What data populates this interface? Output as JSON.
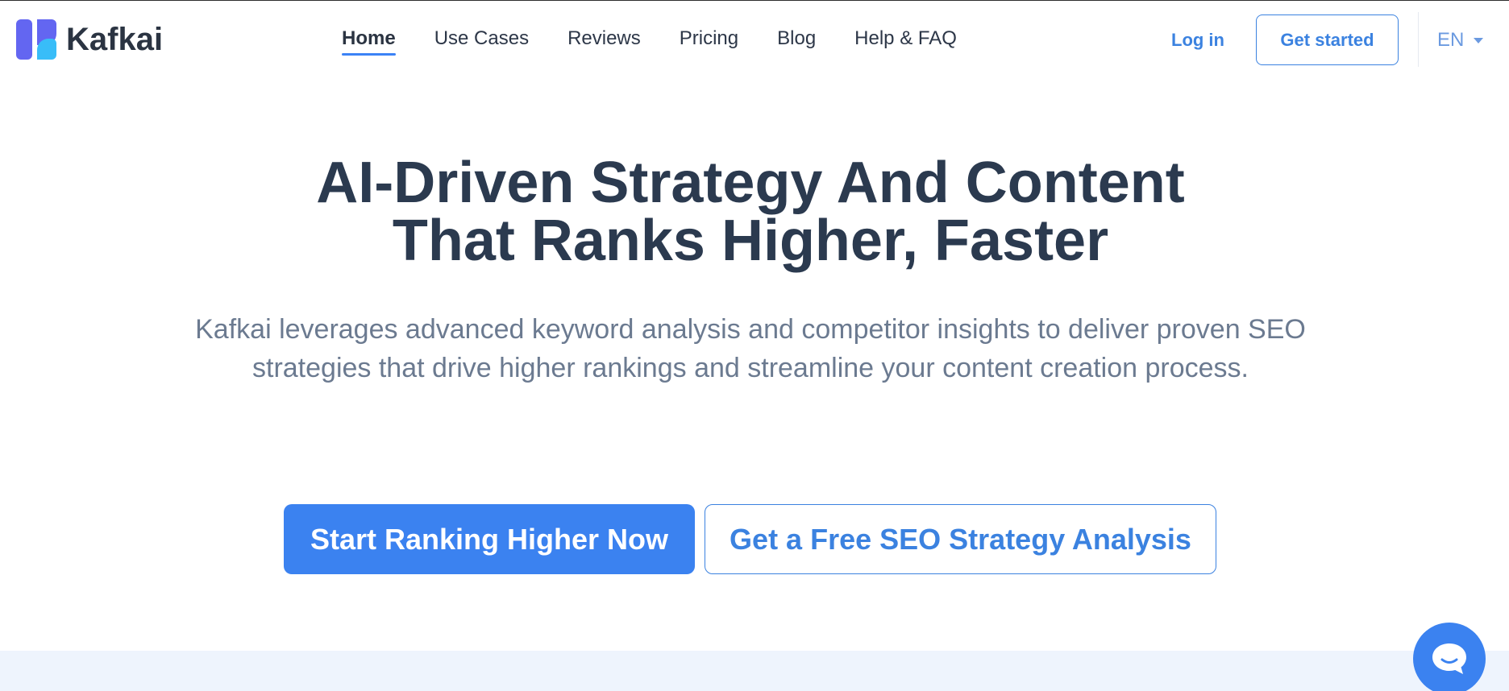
{
  "header": {
    "brand": "Kafkai",
    "nav": [
      {
        "label": "Home",
        "active": true
      },
      {
        "label": "Use Cases"
      },
      {
        "label": "Reviews"
      },
      {
        "label": "Pricing"
      },
      {
        "label": "Blog"
      },
      {
        "label": "Help & FAQ"
      }
    ],
    "login_label": "Log in",
    "get_started_label": "Get started",
    "language": "EN"
  },
  "hero": {
    "title_line1": "AI-Driven Strategy And Content",
    "title_line2": "That Ranks Higher, Faster",
    "subtitle": "Kafkai leverages advanced keyword analysis and competitor insights to deliver proven SEO strategies that drive higher rankings and streamline your content creation process.",
    "primary_cta": "Start Ranking Higher Now",
    "secondary_cta": "Get a Free SEO Strategy Analysis"
  },
  "colors": {
    "accent": "#3b82f0",
    "heading": "#2b3a4f",
    "subtext": "#6b7a90",
    "logo_purple": "#6366f1",
    "logo_cyan": "#38bdf8"
  },
  "icons": {
    "logo": "kafkai-logo-icon",
    "language_caret": "caret-down-icon",
    "chat": "chat-bubble-icon"
  }
}
